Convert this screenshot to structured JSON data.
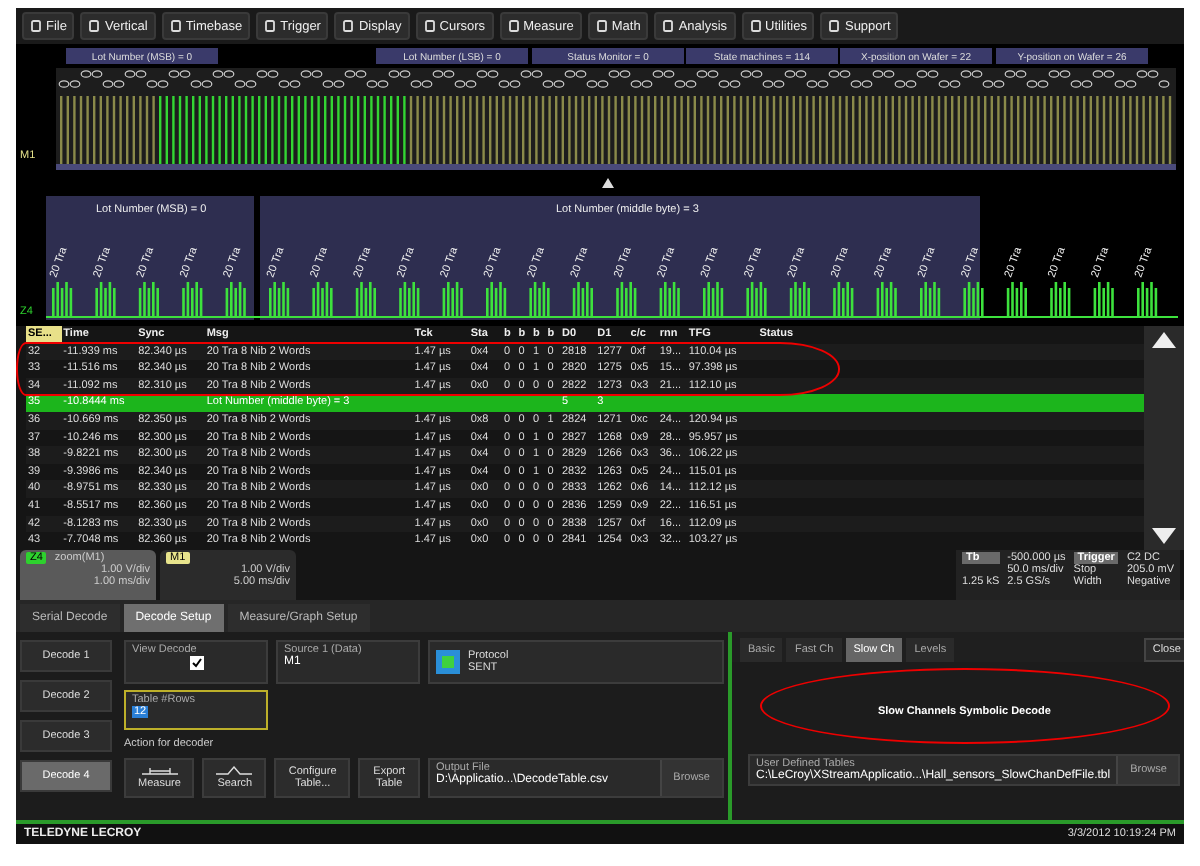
{
  "menu": [
    "File",
    "Vertical",
    "Timebase",
    "Trigger",
    "Display",
    "Cursors",
    "Measure",
    "Math",
    "Analysis",
    "Utilities",
    "Support"
  ],
  "waveform": {
    "top_trace": {
      "channel": "M1",
      "labels": [
        "Lot Number (MSB) = 0",
        "Lot Number (LSB) = 0",
        "Status Monitor = 0",
        "State machines = 114",
        "X-position on Wafer = 22",
        "Y-position on Wafer = 26"
      ]
    },
    "bottom_trace": {
      "channel": "Z4",
      "labels": [
        "Lot Number (MSB) = 0",
        "Lot Number (middle byte) = 3"
      ],
      "frame_labels": [
        "20 Tra",
        "20 Tra",
        "20 Tra",
        "20 Tra",
        "20 Tra",
        "20 Tra",
        "20 Tra",
        "20 Tra",
        "20 Tra",
        "20 Tra",
        "20 Tra",
        "20 Tra",
        "20 Tra",
        "20 Tra",
        "20 Tra",
        "20 Tra",
        "20 Tra",
        "20 Tra",
        "20 Tra",
        "20 Tra",
        "20 Tra",
        "20 Tra",
        "20 Tra",
        "20 Tra",
        "20 Tra",
        "20 Tra"
      ]
    }
  },
  "table": {
    "circled": true,
    "columns": [
      "SE...",
      "Time",
      "Sync",
      "Msg",
      "Tck",
      "Sta",
      "b",
      "b",
      "b",
      "b",
      "D0",
      "D1",
      "c/c",
      "rnn",
      "TFG",
      "Status"
    ],
    "rows": [
      {
        "selected": false,
        "cells": [
          "32",
          "-11.939 ms",
          "82.340 µs",
          "20 Tra  8 Nib  2 Words",
          "1.47 µs",
          "0x4",
          "0",
          "0",
          "1",
          "0",
          "2818",
          "1277",
          "0xf",
          "19...",
          "110.04 µs",
          ""
        ]
      },
      {
        "selected": false,
        "cells": [
          "33",
          "-11.516 ms",
          "82.340 µs",
          "20 Tra  8 Nib  2 Words",
          "1.47 µs",
          "0x4",
          "0",
          "0",
          "1",
          "0",
          "2820",
          "1275",
          "0x5",
          "15...",
          "97.398 µs",
          ""
        ]
      },
      {
        "selected": false,
        "cells": [
          "34",
          "-11.092 ms",
          "82.310 µs",
          "20 Tra  8 Nib  2 Words",
          "1.47 µs",
          "0x0",
          "0",
          "0",
          "0",
          "0",
          "2822",
          "1273",
          "0x3",
          "21...",
          "112.10 µs",
          ""
        ]
      },
      {
        "selected": true,
        "cells": [
          "35",
          "-10.8444 ms",
          "",
          "Lot Number (middle byte) = 3",
          "",
          "",
          "",
          "",
          "",
          "",
          "5",
          "3",
          "",
          "",
          "",
          ""
        ]
      },
      {
        "selected": false,
        "cells": [
          "36",
          "-10.669 ms",
          "82.350 µs",
          "20 Tra  8 Nib  2 Words",
          "1.47 µs",
          "0x8",
          "0",
          "0",
          "0",
          "1",
          "2824",
          "1271",
          "0xc",
          "24...",
          "120.94 µs",
          ""
        ]
      },
      {
        "selected": false,
        "cells": [
          "37",
          "-10.246 ms",
          "82.300 µs",
          "20 Tra  8 Nib  2 Words",
          "1.47 µs",
          "0x4",
          "0",
          "0",
          "1",
          "0",
          "2827",
          "1268",
          "0x9",
          "28...",
          "95.957 µs",
          ""
        ]
      },
      {
        "selected": false,
        "cells": [
          "38",
          "-9.8221 ms",
          "82.300 µs",
          "20 Tra  8 Nib  2 Words",
          "1.47 µs",
          "0x4",
          "0",
          "0",
          "1",
          "0",
          "2829",
          "1266",
          "0x3",
          "36...",
          "106.22 µs",
          ""
        ]
      },
      {
        "selected": false,
        "cells": [
          "39",
          "-9.3986 ms",
          "82.340 µs",
          "20 Tra  8 Nib  2 Words",
          "1.47 µs",
          "0x4",
          "0",
          "0",
          "1",
          "0",
          "2832",
          "1263",
          "0x5",
          "24...",
          "115.01 µs",
          ""
        ]
      },
      {
        "selected": false,
        "cells": [
          "40",
          "-8.9751 ms",
          "82.330 µs",
          "20 Tra  8 Nib  2 Words",
          "1.47 µs",
          "0x0",
          "0",
          "0",
          "0",
          "0",
          "2833",
          "1262",
          "0x6",
          "14...",
          "112.12 µs",
          ""
        ]
      },
      {
        "selected": false,
        "cells": [
          "41",
          "-8.5517 ms",
          "82.360 µs",
          "20 Tra  8 Nib  2 Words",
          "1.47 µs",
          "0x0",
          "0",
          "0",
          "0",
          "0",
          "2836",
          "1259",
          "0x9",
          "22...",
          "116.51 µs",
          ""
        ]
      },
      {
        "selected": false,
        "cells": [
          "42",
          "-8.1283 ms",
          "82.330 µs",
          "20 Tra  8 Nib  2 Words",
          "1.47 µs",
          "0x0",
          "0",
          "0",
          "0",
          "0",
          "2838",
          "1257",
          "0xf",
          "16...",
          "112.09 µs",
          ""
        ]
      },
      {
        "selected": false,
        "cells": [
          "43",
          "-7.7048 ms",
          "82.360 µs",
          "20 Tra  8 Nib  2 Words",
          "1.47 µs",
          "0x0",
          "0",
          "0",
          "0",
          "0",
          "2841",
          "1254",
          "0x3",
          "32...",
          "103.27 µs",
          ""
        ]
      }
    ]
  },
  "descriptors": [
    {
      "badge": "Z4",
      "title": "zoom(M1)",
      "vdiv": "1.00 V/div",
      "tdiv": "1.00 ms/div",
      "selected": true
    },
    {
      "badge": "M1",
      "vdiv": "1.00 V/div",
      "tdiv": "5.00 ms/div",
      "selected": false
    }
  ],
  "timebase": {
    "label": "Tb",
    "delay": "-500.000 µs",
    "tdiv": "50.0 ms/div",
    "samples": "1.25 kS",
    "rate": "2.5 GS/s"
  },
  "trigger": {
    "label": "Trigger",
    "coupling": "C2 DC",
    "mode": "Stop",
    "level": "205.0 mV",
    "type": "Width",
    "slope": "Negative"
  },
  "tabs": [
    {
      "label": "Serial Decode",
      "selected": false
    },
    {
      "label": "Decode Setup",
      "selected": true
    },
    {
      "label": "Measure/Graph Setup",
      "selected": false
    }
  ],
  "decoders": [
    {
      "label": "Decode 1",
      "selected": false
    },
    {
      "label": "Decode 2",
      "selected": false
    },
    {
      "label": "Decode 3",
      "selected": false
    },
    {
      "label": "Decode 4",
      "selected": true
    }
  ],
  "view_decode": {
    "label": "View Decode",
    "checked": true
  },
  "source": {
    "label": "Source 1 (Data)",
    "value": "M1"
  },
  "protocol": {
    "label": "Protocol",
    "value": "SENT"
  },
  "table_rows": {
    "label": "Table #Rows",
    "value": "12"
  },
  "actions": {
    "label": "Action for decoder",
    "buttons": [
      {
        "kind": "measure",
        "label": "Measure"
      },
      {
        "kind": "search",
        "label": "Search"
      },
      {
        "kind": "plain",
        "label": "Configure Table..."
      },
      {
        "kind": "plain",
        "label": "Export Table"
      }
    ]
  },
  "output_file": {
    "label": "Output File",
    "value": "D:\\Applicatio...\\DecodeTable.csv",
    "button": "Browse"
  },
  "right_tabs": [
    {
      "label": "Basic",
      "selected": false
    },
    {
      "label": "Fast Ch",
      "selected": false
    },
    {
      "label": "Slow Ch",
      "selected": true
    },
    {
      "label": "Levels",
      "selected": false
    }
  ],
  "close": "Close",
  "slow_channel": {
    "title": "Slow Channels Symbolic Decode",
    "circled": true
  },
  "user_tables": {
    "label": "User Defined Tables",
    "value": "C:\\LeCroy\\XStreamApplicatio...\\Hall_sensors_SlowChanDefFile.tbl",
    "button": "Browse"
  },
  "footer": {
    "brand": "TELEDYNE LECROY",
    "datetime": "3/3/2012 10:19:24 PM"
  }
}
